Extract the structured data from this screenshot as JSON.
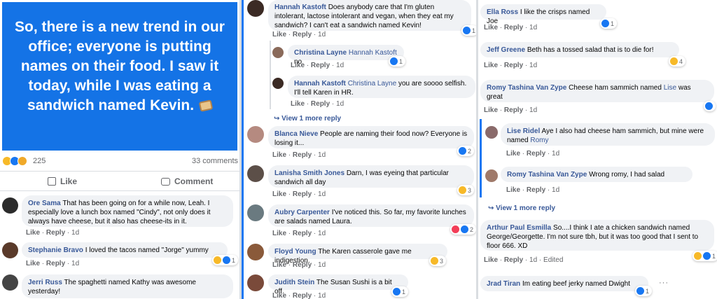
{
  "post": {
    "text": "So, there is a new trend in our office; everyone is putting names on their food. I saw it today, while I was eating a sandwich named Kevin.",
    "reaction_count": "225",
    "comment_count": "33 comments",
    "like_label": "Like",
    "comment_label": "Comment"
  },
  "labels": {
    "like": "Like",
    "reply": "Reply",
    "sep": " · ",
    "view_more": "View 1 more reply",
    "edited": "Edited"
  },
  "colors": {
    "brand_blue": "#1877f2",
    "link_blue": "#385898",
    "bubble_bg": "#f0f2f5",
    "meta_gray": "#65676b"
  },
  "col1": [
    {
      "author": "Ore Sama",
      "text": "That has been going on for a while now, Leah. I especially love a lunch box named \"Cindy\", not only does it always have cheese, but it also has cheese-its in it.",
      "time": "1d"
    },
    {
      "author": "Stephanie Bravo",
      "text": "I loved the tacos named \"Jorge\" yummy",
      "time": "1d",
      "reactions": "1"
    },
    {
      "author": "Jerri Russ",
      "text": "The spaghetti named Kathy was awesome yesterday!",
      "time": ""
    }
  ],
  "col2": [
    {
      "author": "Hannah Kastoft",
      "text": "Does anybody care that I'm gluten intolerant, lactose intolerant and vegan, when they eat my sandwich? I can't eat a sandwich named Kevin!",
      "time": "1d",
      "reactions": "1"
    },
    {
      "author": "Christina Layne",
      "mention": "Hannah Kastoft",
      "text": "no",
      "time": "1d",
      "reactions": "1"
    },
    {
      "author": "Hannah Kastoft",
      "mention": "Christina Layne",
      "text": "you are soooo selfish. I'll tell Karen in HR.",
      "time": "1d"
    },
    {
      "author": "Blanca Nieve",
      "text": "People are naming their food now? Everyone is losing it...",
      "time": "1d",
      "reactions": "2"
    },
    {
      "author": "Lanisha Smith Jones",
      "text": "Darn, I was eyeing that particular sandwich all day",
      "time": "1d",
      "reactions": "3"
    },
    {
      "author": "Aubry Carpenter",
      "text": "I've noticed this. So far, my favorite lunches are salads named Laura.",
      "time": "1d",
      "reactions": "2"
    },
    {
      "author": "Floyd Young",
      "text": "The Karen casserole gave me indigestion.",
      "time": "1d",
      "reactions": "3"
    },
    {
      "author": "Judith Stein",
      "text": "The Susan Sushi is a bit off.",
      "time": "1d",
      "reactions": "1"
    }
  ],
  "col3": [
    {
      "author": "Ella Ross",
      "text": "I like the crisps named Joe",
      "time": "1d",
      "reactions": "1"
    },
    {
      "author": "Jeff Greene",
      "text": "Beth has a tossed salad that is to die for!",
      "time": "1d",
      "reactions": "4"
    },
    {
      "author": "Romy Tashina Van Zype",
      "text": "Cheese ham sammich named",
      "link": "Lise",
      "text2": "was great",
      "time": "1d"
    },
    {
      "author": "Lise Ridel",
      "text": "Aye I also had cheese ham sammich, but mine were named",
      "link": "Romy",
      "time": "1d"
    },
    {
      "author": "Romy Tashina Van Zype",
      "text": "Wrong romy, I had salad",
      "time": "1d"
    },
    {
      "author": "Arthur Paul Esmilla",
      "text": "So....I think I ate a chicken sandwich named George/Georgette. I'm not sure tbh, but it was too good that I sent to floor 666. XD",
      "time": "1d",
      "reactions": "1"
    },
    {
      "author": "Jrad Tiran",
      "text": "Im eating beef jerky named Dwight",
      "time": "",
      "reactions": "1"
    }
  ]
}
